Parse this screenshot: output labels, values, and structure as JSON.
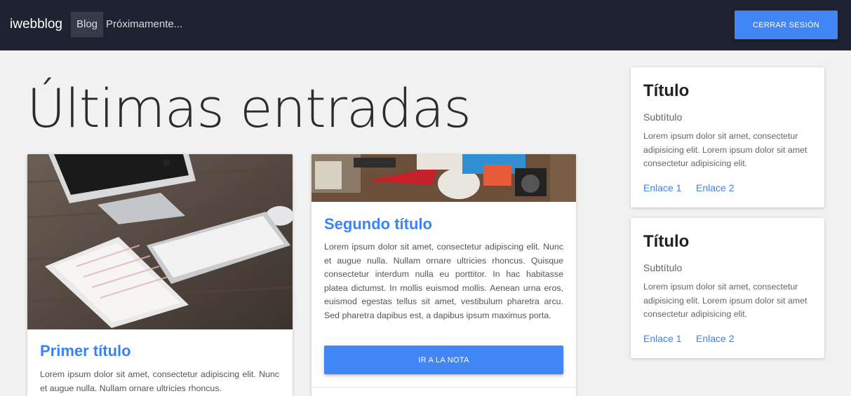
{
  "navbar": {
    "brand": "iwebblog",
    "links": [
      "Blog",
      "Próximamente..."
    ],
    "logout_label": "CERRAR SESIÓN"
  },
  "main": {
    "title": "Últimas entradas",
    "posts": [
      {
        "title": "Primer título",
        "text": "Lorem ipsum dolor sit amet, consectetur adipiscing elit. Nunc et augue nulla. Nullam ornare ultricies rhoncus.",
        "image": "desk-imac-ipad-keyboard-photo"
      },
      {
        "title": "Segundo título",
        "text": "Lorem ipsum dolor sit amet, consectetur adipiscing elit. Nunc et augue nulla. Nullam ornare ultricies rhoncus. Quisque consectetur interdum nulla eu porttitor. In hac habitasse platea dictumst. In mollis euismod mollis. Aenean urna eros, euismod egestas tellus sit amet, vestibulum pharetra arcu. Sed pharetra dapibus est, a dapibus ipsum maximus porta.",
        "image": "back-to-school-desk-photo",
        "button_label": "IR A LA NOTA"
      }
    ]
  },
  "sidebar": {
    "cards": [
      {
        "title": "Título",
        "subtitle": "Subtítulo",
        "text": "Lorem ipsum dolor sit amet, consectetur adipisicing elit. Lorem ipsum dolor sit amet consectetur adipisicing elit.",
        "link1": "Enlace 1",
        "link2": "Enlace 2"
      },
      {
        "title": "Título",
        "subtitle": "Subtítulo",
        "text": "Lorem ipsum dolor sit amet, consectetur adipisicing elit. Lorem ipsum dolor sit amet consectetur adipisicing elit.",
        "link1": "Enlace 1",
        "link2": "Enlace 2"
      }
    ]
  },
  "colors": {
    "navbar_bg": "#1f2230",
    "accent": "#4285f4",
    "link": "#3c82f0",
    "page_bg": "#f1f1f1"
  }
}
